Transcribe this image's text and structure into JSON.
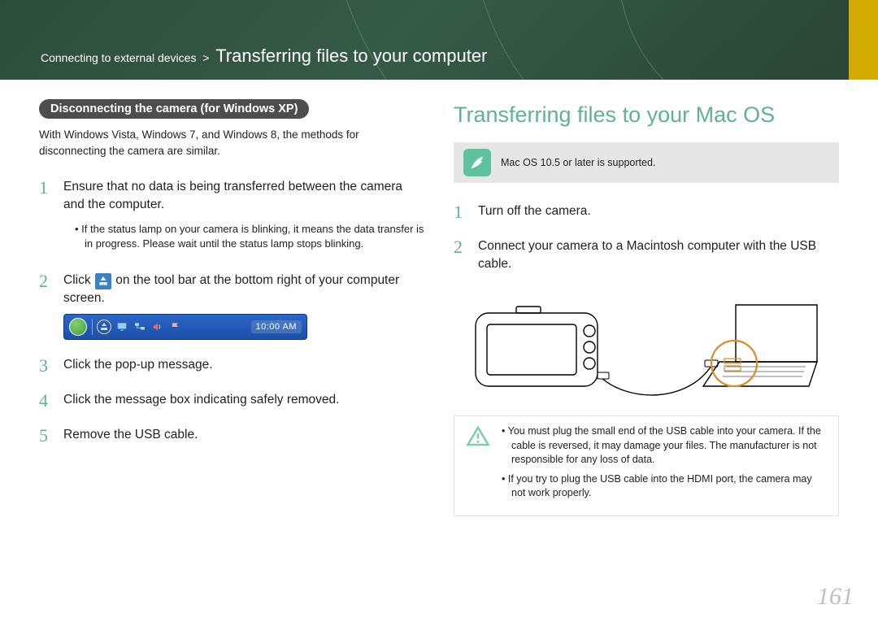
{
  "header": {
    "section": "Connecting to external devices",
    "title": "Transferring files to your computer"
  },
  "left": {
    "subhead": "Disconnecting the camera (for Windows XP)",
    "intro": "With Windows Vista, Windows 7, and Windows 8, the methods for disconnecting the camera are similar.",
    "steps": {
      "s1": "Ensure that no data is being transferred between the camera and the computer.",
      "s1_bullet": "If the status lamp on your camera is blinking, it means the data transfer is in progress. Please wait until the status lamp stops blinking.",
      "s2a": "Click ",
      "s2b": " on the tool bar at the bottom right of your computer screen.",
      "s3": "Click the pop-up message.",
      "s4": "Click the message box indicating safely removed.",
      "s5": "Remove the USB cable."
    },
    "taskbar_time": "10:00 AM"
  },
  "right": {
    "title": "Transferring files to your Mac OS",
    "note": "Mac OS 10.5 or later is supported.",
    "steps": {
      "s1": "Turn off the camera.",
      "s2": "Connect your camera to a Macintosh computer with the USB cable."
    },
    "warn": {
      "w1": "You must plug the small end of the USB cable into your camera. If the cable is reversed, it may damage your files. The manufacturer is not responsible for any loss of data.",
      "w2": "If you try to plug the USB cable into the HDMI port, the camera may not work properly."
    }
  },
  "page_number": "161"
}
